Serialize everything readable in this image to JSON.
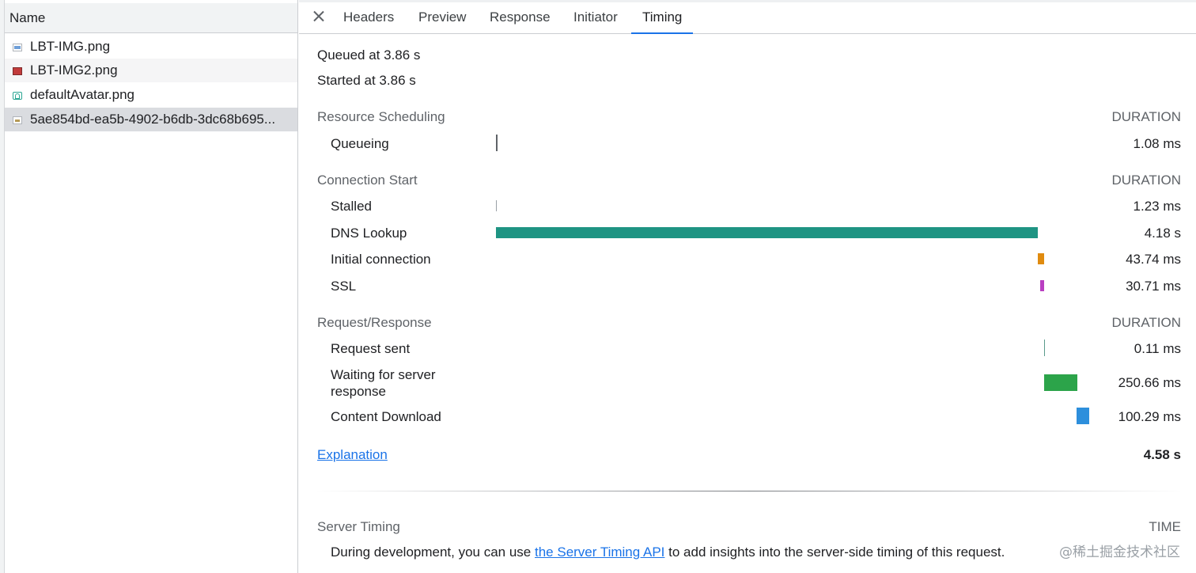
{
  "request_list": {
    "header": "Name",
    "files": [
      {
        "name": "LBT-IMG.png",
        "icon": "image-file-icon"
      },
      {
        "name": "LBT-IMG2.png",
        "icon": "image-file-icon"
      },
      {
        "name": "defaultAvatar.png",
        "icon": "image-file-icon"
      },
      {
        "name": "5ae854bd-ea5b-4902-b6db-3dc68b695...",
        "icon": "image-file-icon",
        "selected": true
      }
    ]
  },
  "tabs": {
    "items": [
      "Headers",
      "Preview",
      "Response",
      "Initiator",
      "Timing"
    ],
    "active": "Timing"
  },
  "timing": {
    "queued": "Queued at 3.86 s",
    "started": "Started at 3.86 s",
    "duration_label": "DURATION",
    "sections": [
      {
        "title": "Resource Scheduling",
        "rows": [
          {
            "label": "Queueing",
            "value": "1.08 ms",
            "color": "#5f6368"
          }
        ]
      },
      {
        "title": "Connection Start",
        "rows": [
          {
            "label": "Stalled",
            "value": "1.23 ms",
            "color": "#9aa0a6"
          },
          {
            "label": "DNS Lookup",
            "value": "4.18 s",
            "color": "#1e9483"
          },
          {
            "label": "Initial connection",
            "value": "43.74 ms",
            "color": "#e08b0f"
          },
          {
            "label": "SSL",
            "value": "30.71 ms",
            "color": "#b93fc1"
          }
        ]
      },
      {
        "title": "Request/Response",
        "rows": [
          {
            "label": "Request sent",
            "value": "0.11 ms",
            "color": "#5a9a8c"
          },
          {
            "label": "Waiting for server response",
            "value": "250.66 ms",
            "color": "#2ca44a"
          },
          {
            "label": "Content Download",
            "value": "100.29 ms",
            "color": "#2d8fdc"
          }
        ]
      }
    ],
    "explanation_link": "Explanation",
    "total": "4.58 s"
  },
  "server_timing": {
    "title": "Server Timing",
    "time_label": "TIME",
    "text_before": "During development, you can use ",
    "link_text": "the Server Timing API",
    "text_after": " to add insights into the server-side timing of this request."
  },
  "watermark": "@稀土掘金技术社区"
}
